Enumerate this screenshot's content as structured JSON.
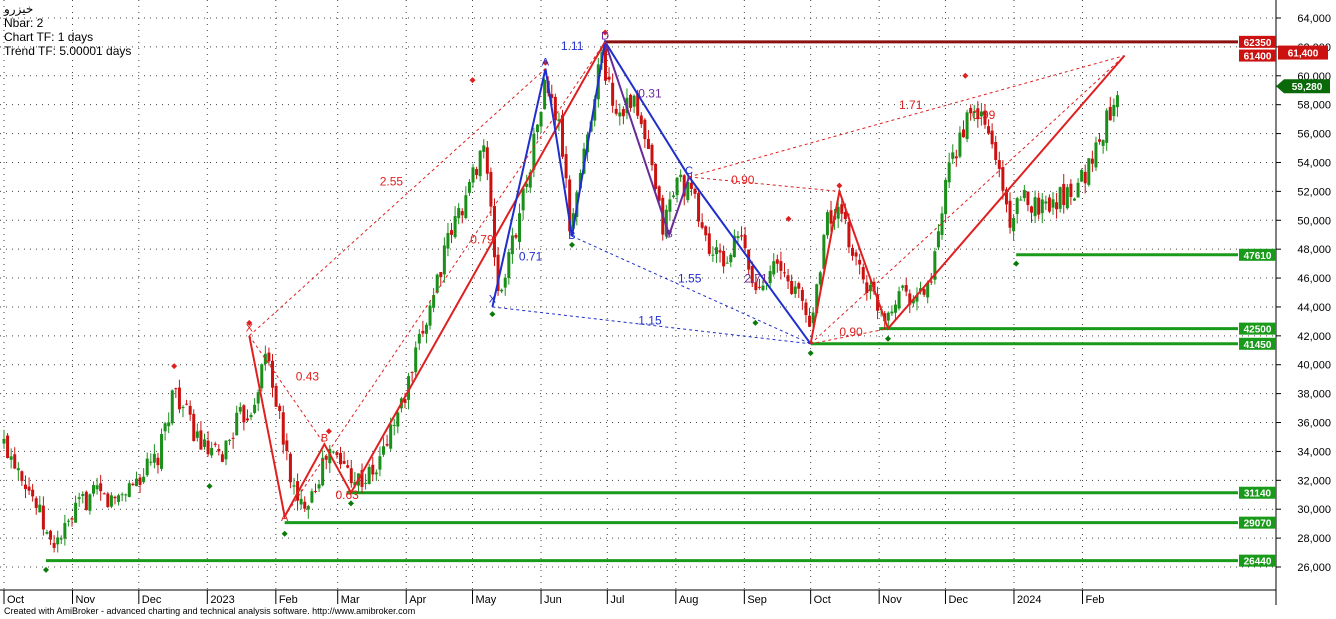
{
  "header": {
    "title": "خيزرو",
    "nbar": "Nbar: 2",
    "chart_tf": "Chart TF: 1 days",
    "trend_tf": "Trend TF: 5.00001 days"
  },
  "footer": {
    "credit": "Created with AmiBroker - advanced charting and technical analysis software. http://www.amibroker.com"
  },
  "colors": {
    "bull": "#1a8f1a",
    "bear": "#cc1111",
    "harmonic_red": "#e02020",
    "harmonic_blue": "#1f2fcc",
    "harmonic_purple": "#6a2a9a",
    "support": "#1a9a1a",
    "resistance": "#8b1010",
    "last_price": "#0a6a0a"
  },
  "chart_data": {
    "type": "candlestick",
    "ylim": [
      25000,
      64500
    ],
    "yticks": [
      26000,
      28000,
      30000,
      32000,
      34000,
      36000,
      38000,
      40000,
      42000,
      44000,
      46000,
      48000,
      50000,
      52000,
      54000,
      56000,
      58000,
      60000,
      62000,
      64000
    ],
    "ytick_labels": [
      "26,000",
      "28,000",
      "30,000",
      "32,000",
      "34,000",
      "36,000",
      "38,000",
      "40,000",
      "42,000",
      "44,000",
      "46,000",
      "48,000",
      "50,000",
      "52,000",
      "54,000",
      "56,000",
      "58,000",
      "60,000",
      "62,000",
      "64,000"
    ],
    "grid": true,
    "start_date": "2022-10-01",
    "months": [
      {
        "label": "Oct",
        "date": "2022-10-01"
      },
      {
        "label": "Nov",
        "date": "2022-11-01"
      },
      {
        "label": "Dec",
        "date": "2022-12-01"
      },
      {
        "label": "2023",
        "date": "2023-01-01"
      },
      {
        "label": "Feb",
        "date": "2023-02-01"
      },
      {
        "label": "Mar",
        "date": "2023-03-01"
      },
      {
        "label": "Apr",
        "date": "2023-04-01"
      },
      {
        "label": "May",
        "date": "2023-05-01"
      },
      {
        "label": "Jun",
        "date": "2023-06-01"
      },
      {
        "label": "Jul",
        "date": "2023-07-01"
      },
      {
        "label": "Aug",
        "date": "2023-08-01"
      },
      {
        "label": "Sep",
        "date": "2023-09-01"
      },
      {
        "label": "Oct",
        "date": "2023-10-01"
      },
      {
        "label": "Nov",
        "date": "2023-11-01"
      },
      {
        "label": "Dec",
        "date": "2023-12-01"
      },
      {
        "label": "2024",
        "date": "2024-01-01"
      },
      {
        "label": "Feb",
        "date": "2024-02-01"
      }
    ],
    "close_path": [
      [
        "2022-10-01",
        34500
      ],
      [
        "2022-10-08",
        33000
      ],
      [
        "2022-10-15",
        30500
      ],
      [
        "2022-10-22",
        27500
      ],
      [
        "2022-10-29",
        28500
      ],
      [
        "2022-11-05",
        30500
      ],
      [
        "2022-11-12",
        31000
      ],
      [
        "2022-11-19",
        30500
      ],
      [
        "2022-11-26",
        31500
      ],
      [
        "2022-12-03",
        32500
      ],
      [
        "2022-12-10",
        33500
      ],
      [
        "2022-12-17",
        38500
      ],
      [
        "2022-12-24",
        36000
      ],
      [
        "2022-12-31",
        34000
      ],
      [
        "2023-01-07",
        33500
      ],
      [
        "2023-01-14",
        36000
      ],
      [
        "2023-01-21",
        37000
      ],
      [
        "2023-01-28",
        41000
      ],
      [
        "2023-02-04",
        35000
      ],
      [
        "2023-02-11",
        30000
      ],
      [
        "2023-02-18",
        31500
      ],
      [
        "2023-02-25",
        34000
      ],
      [
        "2023-03-04",
        33000
      ],
      [
        "2023-03-11",
        32000
      ],
      [
        "2023-03-18",
        32500
      ],
      [
        "2023-03-25",
        35500
      ],
      [
        "2023-04-01",
        38000
      ],
      [
        "2023-04-08",
        42000
      ],
      [
        "2023-04-15",
        46000
      ],
      [
        "2023-04-22",
        49500
      ],
      [
        "2023-04-29",
        52000
      ],
      [
        "2023-05-06",
        55500
      ],
      [
        "2023-05-13",
        44500
      ],
      [
        "2023-05-20",
        49000
      ],
      [
        "2023-05-27",
        54000
      ],
      [
        "2023-06-03",
        59500
      ],
      [
        "2023-06-10",
        56000
      ],
      [
        "2023-06-14",
        49500
      ],
      [
        "2023-06-21",
        55000
      ],
      [
        "2023-06-28",
        61500
      ],
      [
        "2023-07-05",
        57500
      ],
      [
        "2023-07-12",
        58500
      ],
      [
        "2023-07-19",
        55000
      ],
      [
        "2023-07-26",
        49500
      ],
      [
        "2023-08-02",
        53000
      ],
      [
        "2023-08-09",
        51500
      ],
      [
        "2023-08-16",
        48000
      ],
      [
        "2023-08-23",
        47000
      ],
      [
        "2023-08-30",
        49000
      ],
      [
        "2023-09-06",
        45000
      ],
      [
        "2023-09-13",
        47000
      ],
      [
        "2023-09-20",
        46000
      ],
      [
        "2023-09-27",
        44500
      ],
      [
        "2023-10-01",
        42500
      ],
      [
        "2023-10-08",
        50000
      ],
      [
        "2023-10-14",
        50500
      ],
      [
        "2023-10-21",
        47500
      ],
      [
        "2023-10-28",
        45000
      ],
      [
        "2023-11-04",
        43500
      ],
      [
        "2023-11-11",
        45500
      ],
      [
        "2023-11-18",
        44500
      ],
      [
        "2023-11-25",
        46000
      ],
      [
        "2023-12-02",
        53000
      ],
      [
        "2023-12-09",
        56500
      ],
      [
        "2023-12-16",
        57500
      ],
      [
        "2023-12-23",
        55000
      ],
      [
        "2023-12-30",
        50000
      ],
      [
        "2024-01-06",
        51500
      ],
      [
        "2024-01-13",
        51000
      ],
      [
        "2024-01-20",
        51500
      ],
      [
        "2024-01-27",
        52000
      ],
      [
        "2024-02-03",
        53500
      ],
      [
        "2024-02-10",
        56000
      ],
      [
        "2024-02-17",
        59280
      ]
    ],
    "last_price": {
      "value": 59280,
      "label": "59,280"
    },
    "price_tags": [
      {
        "value": 62350,
        "label": "62350",
        "color": "#cc1111"
      },
      {
        "value": 61400,
        "label": "61400",
        "color": "#cc1111"
      },
      {
        "value": 47610,
        "label": "47610",
        "color": "#1a9a1a"
      },
      {
        "value": 42500,
        "label": "42500",
        "color": "#1a9a1a"
      },
      {
        "value": 41450,
        "label": "41450",
        "color": "#1a9a1a"
      },
      {
        "value": 31140,
        "label": "31140",
        "color": "#1a9a1a"
      },
      {
        "value": 29070,
        "label": "29070",
        "color": "#1a9a1a"
      },
      {
        "value": 26440,
        "label": "26440",
        "color": "#1a9a1a"
      }
    ],
    "price_tag_top": {
      "value": 61400,
      "label": "61,400"
    },
    "levels": [
      {
        "value": 62350,
        "from": "2023-06-30",
        "color": "#8b1010"
      },
      {
        "value": 47610,
        "from": "2024-01-02",
        "color": "#1a9a1a"
      },
      {
        "value": 42500,
        "from": "2023-11-01",
        "color": "#1a9a1a"
      },
      {
        "value": 41450,
        "from": "2023-10-01",
        "color": "#1a9a1a"
      },
      {
        "value": 31140,
        "from": "2023-03-05",
        "color": "#1a9a1a"
      },
      {
        "value": 29070,
        "from": "2023-02-05",
        "color": "#1a9a1a"
      },
      {
        "value": 26440,
        "from": "2022-10-20",
        "color": "#1a9a1a"
      }
    ],
    "harmonic_lines": [
      {
        "color": "#e02020",
        "dashed": false,
        "points": [
          [
            "2023-01-20",
            42000
          ],
          [
            "2023-02-05",
            29500
          ],
          [
            "2023-02-23",
            34500
          ],
          [
            "2023-03-07",
            31140
          ],
          [
            "2023-06-30",
            62350
          ]
        ]
      },
      {
        "color": "#1f2fcc",
        "dashed": false,
        "points": [
          [
            "2023-05-10",
            44000
          ],
          [
            "2023-06-03",
            60500
          ],
          [
            "2023-06-15",
            48900
          ],
          [
            "2023-06-30",
            62350
          ],
          [
            "2023-08-07",
            53000
          ],
          [
            "2023-10-01",
            41450
          ]
        ]
      },
      {
        "color": "#6a2a9a",
        "dashed": false,
        "points": [
          [
            "2023-06-30",
            62350
          ],
          [
            "2023-07-29",
            49000
          ],
          [
            "2023-08-07",
            53000
          ]
        ]
      },
      {
        "color": "#e02020",
        "dashed": false,
        "points": [
          [
            "2023-10-01",
            41450
          ],
          [
            "2023-10-14",
            52000
          ],
          [
            "2023-11-05",
            42500
          ],
          [
            "2024-02-20",
            61400
          ]
        ]
      },
      {
        "color": "#e02020",
        "dashed": true,
        "points": [
          [
            "2023-01-20",
            42000
          ],
          [
            "2023-06-03",
            60500
          ]
        ]
      },
      {
        "color": "#e02020",
        "dashed": true,
        "points": [
          [
            "2023-02-05",
            29500
          ],
          [
            "2023-06-30",
            62350
          ]
        ]
      },
      {
        "color": "#e02020",
        "dashed": true,
        "points": [
          [
            "2023-01-20",
            42000
          ],
          [
            "2023-02-23",
            34500
          ],
          [
            "2023-03-07",
            31140
          ]
        ]
      },
      {
        "color": "#1f2fcc",
        "dashed": true,
        "points": [
          [
            "2023-05-10",
            44000
          ],
          [
            "2023-10-01",
            41450
          ]
        ]
      },
      {
        "color": "#1f2fcc",
        "dashed": true,
        "points": [
          [
            "2023-06-15",
            48900
          ],
          [
            "2023-10-01",
            41450
          ]
        ]
      },
      {
        "color": "#e02020",
        "dashed": true,
        "points": [
          [
            "2023-08-07",
            53000
          ],
          [
            "2023-10-14",
            52000
          ]
        ]
      },
      {
        "color": "#e02020",
        "dashed": true,
        "points": [
          [
            "2023-08-07",
            53000
          ],
          [
            "2024-02-20",
            61400
          ]
        ]
      },
      {
        "color": "#e02020",
        "dashed": true,
        "points": [
          [
            "2023-10-01",
            41450
          ],
          [
            "2024-02-20",
            61400
          ]
        ]
      },
      {
        "color": "#e02020",
        "dashed": true,
        "points": [
          [
            "2023-10-01",
            41450
          ],
          [
            "2023-11-05",
            42500
          ]
        ]
      }
    ],
    "ratio_labels": [
      {
        "text": "2.55",
        "date": "2023-03-20",
        "value": 52400,
        "color": "#e02020"
      },
      {
        "text": "0.79",
        "date": "2023-04-30",
        "value": 48400,
        "color": "#e02020"
      },
      {
        "text": "0.43",
        "date": "2023-02-10",
        "value": 38900,
        "color": "#e02020"
      },
      {
        "text": "0.63",
        "date": "2023-02-28",
        "value": 30700,
        "color": "#e02020"
      },
      {
        "text": "1.11",
        "date": "2023-06-10",
        "value": 61800,
        "color": "#1f2fcc"
      },
      {
        "text": "0.71",
        "date": "2023-05-22",
        "value": 47200,
        "color": "#1f2fcc"
      },
      {
        "text": "0.31",
        "date": "2023-07-15",
        "value": 58500,
        "color": "#6a2a9a"
      },
      {
        "text": "1.55",
        "date": "2023-08-02",
        "value": 45700,
        "color": "#1f2fcc"
      },
      {
        "text": "2.71",
        "date": "2023-09-01",
        "value": 45700,
        "color": "#6a2a9a"
      },
      {
        "text": "1.15",
        "date": "2023-07-15",
        "value": 42800,
        "color": "#1f2fcc"
      },
      {
        "text": "0.90",
        "date": "2023-08-26",
        "value": 52500,
        "color": "#e02020"
      },
      {
        "text": "0.90",
        "date": "2023-10-14",
        "value": 42000,
        "color": "#e02020"
      },
      {
        "text": "1.71",
        "date": "2023-11-10",
        "value": 57700,
        "color": "#e02020"
      },
      {
        "text": "0.99",
        "date": "2023-12-13",
        "value": 57000,
        "color": "#e02020"
      }
    ],
    "point_labels": [
      {
        "text": "X",
        "date": "2023-01-20",
        "value": 42300,
        "color": "#e02020"
      },
      {
        "text": "A",
        "date": "2023-02-05",
        "value": 29200,
        "color": "#e02020"
      },
      {
        "text": "B",
        "date": "2023-02-23",
        "value": 34700,
        "color": "#e02020"
      },
      {
        "text": "X",
        "date": "2023-05-10",
        "value": 44300,
        "color": "#1f2fcc"
      },
      {
        "text": "A",
        "date": "2023-06-03",
        "value": 60700,
        "color": "#1f2fcc"
      },
      {
        "text": "B",
        "date": "2023-06-15",
        "value": 48700,
        "color": "#1f2fcc"
      },
      {
        "text": "D",
        "date": "2023-06-30",
        "value": 62500,
        "color": "#6a2a9a"
      },
      {
        "text": "B",
        "date": "2023-07-29",
        "value": 48800,
        "color": "#6a2a9a"
      },
      {
        "text": "C",
        "date": "2023-08-07",
        "value": 53200,
        "color": "#1f2fcc"
      }
    ],
    "pivots": [
      {
        "date": "2022-12-17",
        "value": 39900,
        "type": "high"
      },
      {
        "date": "2023-01-20",
        "value": 42900,
        "type": "high"
      },
      {
        "date": "2023-02-25",
        "value": 35400,
        "type": "high"
      },
      {
        "date": "2023-05-01",
        "value": 59700,
        "type": "high"
      },
      {
        "date": "2023-06-03",
        "value": 60900,
        "type": "high"
      },
      {
        "date": "2023-06-30",
        "value": 63000,
        "type": "high"
      },
      {
        "date": "2023-09-21",
        "value": 50100,
        "type": "high"
      },
      {
        "date": "2023-10-14",
        "value": 52400,
        "type": "high"
      },
      {
        "date": "2023-12-10",
        "value": 60000,
        "type": "high"
      },
      {
        "date": "2022-10-20",
        "value": 25800,
        "type": "low"
      },
      {
        "date": "2023-01-02",
        "value": 31600,
        "type": "low"
      },
      {
        "date": "2023-02-05",
        "value": 28300,
        "type": "low"
      },
      {
        "date": "2023-03-07",
        "value": 30400,
        "type": "low"
      },
      {
        "date": "2023-05-10",
        "value": 43500,
        "type": "low"
      },
      {
        "date": "2023-06-15",
        "value": 48300,
        "type": "low"
      },
      {
        "date": "2023-09-06",
        "value": 42900,
        "type": "low"
      },
      {
        "date": "2023-10-01",
        "value": 40800,
        "type": "low"
      },
      {
        "date": "2023-11-05",
        "value": 41800,
        "type": "low"
      },
      {
        "date": "2024-01-02",
        "value": 47000,
        "type": "low"
      }
    ]
  }
}
